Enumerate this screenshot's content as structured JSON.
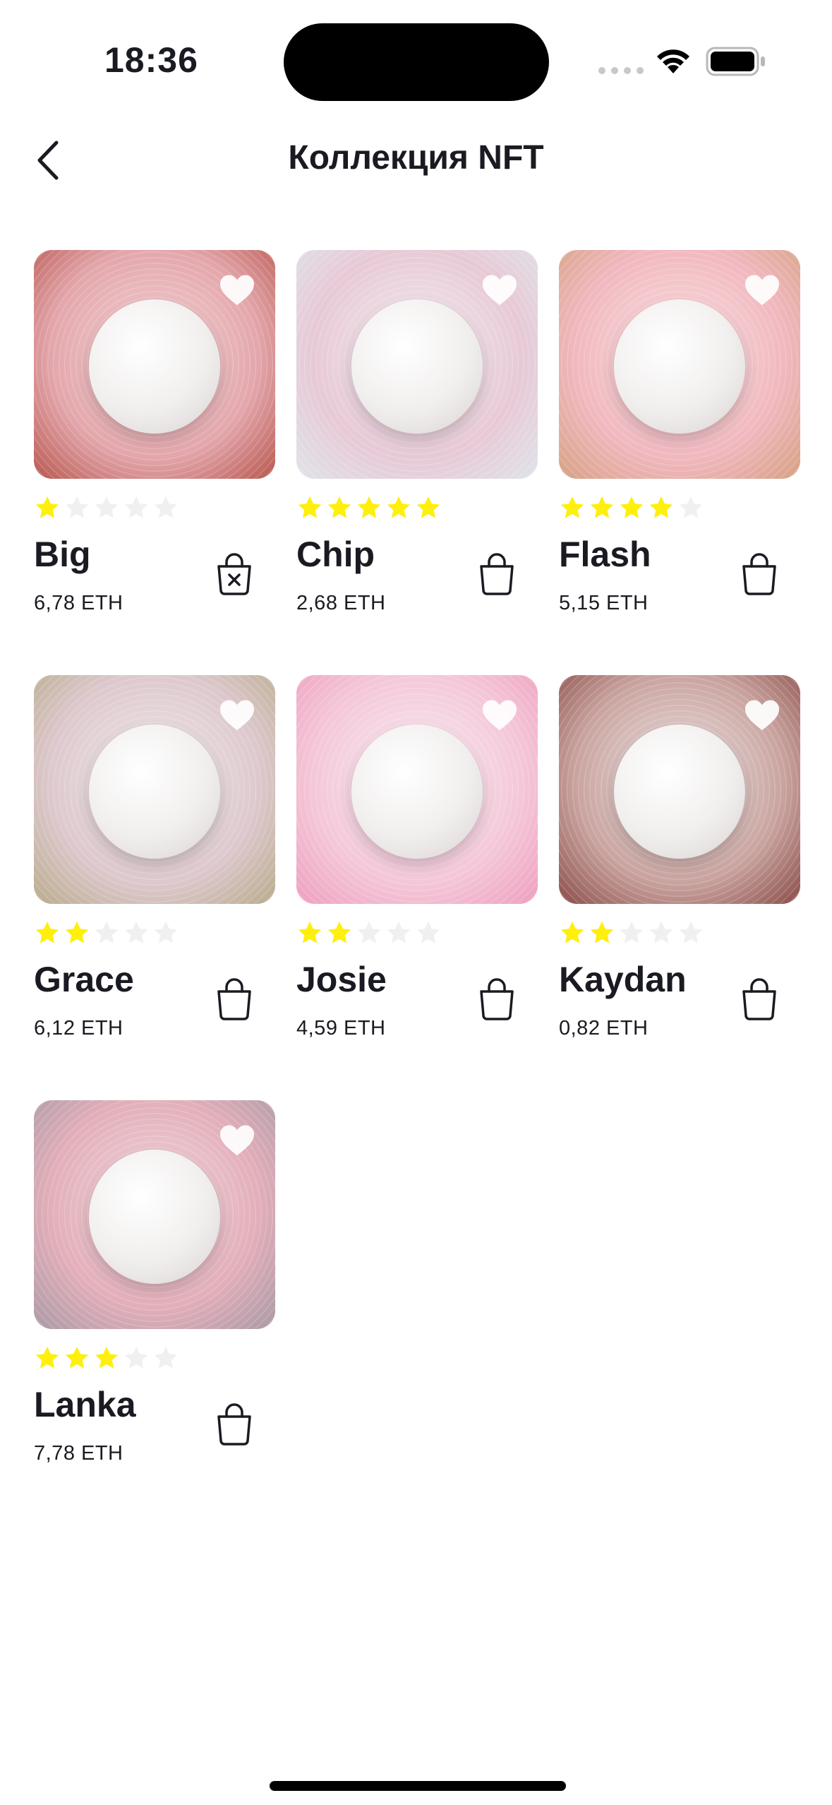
{
  "status_bar": {
    "time": "18:36"
  },
  "header": {
    "title": "Коллекция NFT",
    "back_icon": "chevron-left-icon"
  },
  "colors": {
    "star_active": "#FEEF0D",
    "star_inactive": "#F0F0F0",
    "text": "#1A1B22"
  },
  "items": [
    {
      "name": "Big",
      "price": "6,78 ETH",
      "rating": 1,
      "in_cart": true,
      "liked": true,
      "palette": [
        "#f4d6d8",
        "#e3a6ab",
        "#b8574f"
      ]
    },
    {
      "name": "Chip",
      "price": "2,68 ETH",
      "rating": 5,
      "in_cart": false,
      "liked": true,
      "palette": [
        "#f3eef0",
        "#e7c9d6",
        "#dfe4e9"
      ]
    },
    {
      "name": "Flash",
      "price": "5,15 ETH",
      "rating": 4,
      "in_cart": false,
      "liked": true,
      "palette": [
        "#f8e3e3",
        "#f1b8bf",
        "#d6a183"
      ]
    },
    {
      "name": "Grace",
      "price": "6,12 ETH",
      "rating": 2,
      "in_cart": false,
      "liked": true,
      "palette": [
        "#efe9ea",
        "#ddc8cd",
        "#b9ab8c"
      ]
    },
    {
      "name": "Josie",
      "price": "4,59 ETH",
      "rating": 2,
      "in_cart": false,
      "liked": true,
      "palette": [
        "#f8eef2",
        "#f4c7d8",
        "#ee9fbe"
      ]
    },
    {
      "name": "Kaydan",
      "price": "0,82 ETH",
      "rating": 2,
      "in_cart": false,
      "liked": true,
      "palette": [
        "#ece6e6",
        "#c9a39f",
        "#8a4d48"
      ]
    },
    {
      "name": "Lanka",
      "price": "7,78 ETH",
      "rating": 3,
      "in_cart": false,
      "liked": true,
      "palette": [
        "#f3d9df",
        "#e2aeb9",
        "#a99aa6"
      ]
    }
  ]
}
